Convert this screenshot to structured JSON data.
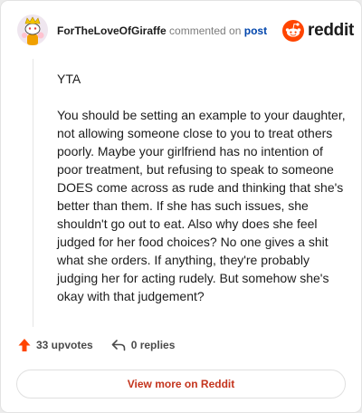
{
  "header": {
    "author": "ForTheLoveOfGiraffe",
    "action": "commented on",
    "post_link": "post",
    "logo_text": "reddit"
  },
  "comment": {
    "paragraphs": [
      "YTA",
      "You should be setting an example to your daughter, not allowing someone close to you to treat others poorly. Maybe your girlfriend has no intention of poor treatment, but refusing to speak to someone DOES come across as rude and thinking that she's better than them. If she has such issues, she shouldn't go out to eat. Also why does she feel judged for her food choices? No one gives a shit what she orders. If anything, they're probably judging her for acting rudely. But somehow she's okay with that judgement?"
    ]
  },
  "actions": {
    "upvotes": "33 upvotes",
    "replies": "0 replies"
  },
  "footer": {
    "view_more": "View more on Reddit"
  },
  "colors": {
    "reddit_orange": "#ff4500",
    "link_blue": "#0045ac",
    "view_more_red": "#c4341d"
  },
  "icons": {
    "avatar": "snoo-avatar-icon",
    "logo": "reddit-snoo-icon",
    "upvote": "upvote-arrow-icon",
    "reply": "reply-arrow-icon"
  }
}
